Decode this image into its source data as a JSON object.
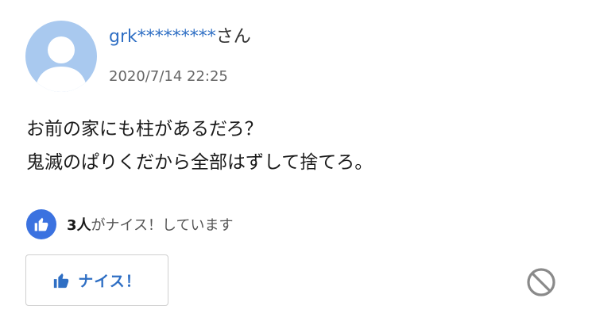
{
  "comment": {
    "user": {
      "id": "grk*********",
      "suffix": "さん",
      "avatar_icon": "default-user-avatar"
    },
    "timestamp": "2020/7/14 22:25",
    "body_lines": [
      "お前の家にも柱があるだろ？",
      "鬼滅のぱりくだから全部はずして捨てろ。"
    ],
    "likes": {
      "count": "3人",
      "suffix_text": "がナイス！しています",
      "icon": "thumbs-up-icon"
    },
    "nice_button": {
      "label": "ナイス！",
      "icon": "thumbs-up-icon"
    },
    "block_icon": "prohibited-icon"
  },
  "colors": {
    "link": "#2f6fc4",
    "accent": "#3b72e0",
    "avatar": "#a9c9ef",
    "muted": "#666666"
  }
}
